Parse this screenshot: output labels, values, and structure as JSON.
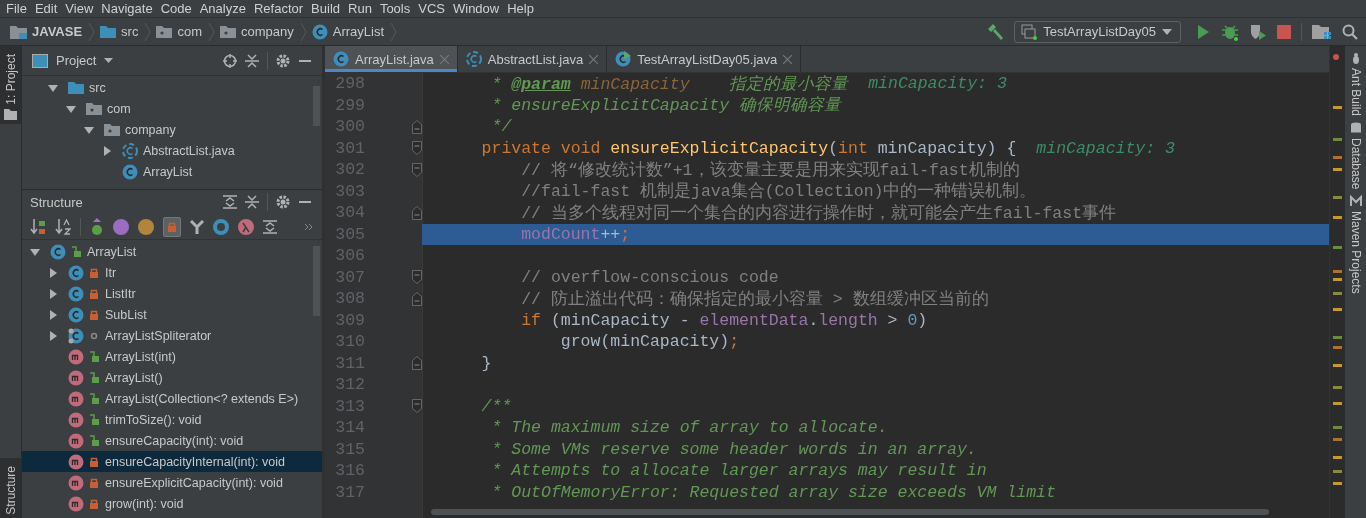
{
  "menu": [
    "File",
    "Edit",
    "View",
    "Navigate",
    "Code",
    "Analyze",
    "Refactor",
    "Build",
    "Run",
    "Tools",
    "VCS",
    "Window",
    "Help"
  ],
  "breadcrumbs": [
    {
      "label": "JAVASE",
      "kind": "module"
    },
    {
      "label": "src",
      "kind": "source"
    },
    {
      "label": "com",
      "kind": "package"
    },
    {
      "label": "company",
      "kind": "package"
    },
    {
      "label": "ArrayList",
      "kind": "class"
    }
  ],
  "run_config": "TestArrayListDay05",
  "left_tool_tabs": [
    {
      "label": "1: Project",
      "selected": true
    },
    {
      "label": "Structure",
      "selected": true
    }
  ],
  "right_tool_tabs": [
    {
      "label": "Ant Build",
      "kind": "ant"
    },
    {
      "label": "Database",
      "kind": "database"
    },
    {
      "label": "Maven Projects",
      "kind": "maven"
    }
  ],
  "project_panel": {
    "title": "Project",
    "tree": [
      {
        "label": "src",
        "kind": "source",
        "expanded": true,
        "children": [
          {
            "label": "com",
            "kind": "package",
            "expanded": true,
            "children": [
              {
                "label": "company",
                "kind": "package",
                "expanded": true,
                "children": [
                  {
                    "label": "AbstractList.java",
                    "kind": "abstract",
                    "expanded": false
                  },
                  {
                    "label": "ArrayList",
                    "kind": "class"
                  }
                ]
              }
            ]
          }
        ]
      }
    ]
  },
  "structure_panel": {
    "title": "Structure",
    "tree": [
      {
        "label": "ArrayList",
        "kind": "class",
        "locked": false,
        "expanded": true,
        "selected": false,
        "children": [
          {
            "label": "Itr",
            "kind": "class",
            "locked": true,
            "expanded": false,
            "selected": false
          },
          {
            "label": "ListItr",
            "kind": "class",
            "locked": true,
            "expanded": false,
            "selected": false
          },
          {
            "label": "SubList",
            "kind": "class",
            "locked": true,
            "expanded": false,
            "selected": false
          },
          {
            "label": "ArrayListSpliterator",
            "kind": "static_class",
            "expanded": false,
            "selected": false
          },
          {
            "label": "ArrayList(int)",
            "kind": "method",
            "locked": false,
            "selected": false
          },
          {
            "label": "ArrayList()",
            "kind": "method",
            "locked": false,
            "selected": false
          },
          {
            "label": "ArrayList(Collection<? extends E>)",
            "kind": "method",
            "locked": false,
            "selected": false
          },
          {
            "label": "trimToSize(): void",
            "kind": "method",
            "locked": false,
            "selected": false
          },
          {
            "label": "ensureCapacity(int): void",
            "kind": "method",
            "locked": false,
            "selected": false
          },
          {
            "label": "ensureCapacityInternal(int): void",
            "kind": "method",
            "locked": true,
            "selected": true
          },
          {
            "label": "ensureExplicitCapacity(int): void",
            "kind": "method",
            "locked": true,
            "selected": false
          },
          {
            "label": "grow(int): void",
            "kind": "method",
            "locked": true,
            "selected": false
          }
        ]
      }
    ]
  },
  "editor_tabs": [
    {
      "label": "ArrayList.java",
      "kind": "class",
      "selected": true
    },
    {
      "label": "AbstractList.java",
      "kind": "abstract",
      "selected": false
    },
    {
      "label": "TestArrayListDay05.java",
      "kind": "runnable",
      "selected": false
    }
  ],
  "code": [
    {
      "number": "298",
      "fold_start": false,
      "fold_end": false,
      "highlighted": false,
      "tokens": [
        {
          "kind": "doc",
          "text": "     * "
        },
        {
          "kind": "doctag",
          "text": "@param"
        },
        {
          "kind": "docname",
          "text": " minCapacity"
        },
        {
          "kind": "doc",
          "text": "    指定的最小容量"
        }
      ],
      "hint": "minCapacity: 3"
    },
    {
      "number": "299",
      "fold_start": false,
      "fold_end": false,
      "highlighted": false,
      "tokens": [
        {
          "kind": "doc",
          "text": "     * ensureExplicitCapacity 确保明确容量"
        }
      ]
    },
    {
      "number": "300",
      "fold_start": false,
      "fold_end": true,
      "highlighted": false,
      "tokens": [
        {
          "kind": "doc",
          "text": "     */"
        }
      ]
    },
    {
      "number": "301",
      "fold_start": true,
      "fold_end": false,
      "highlighted": false,
      "tokens": [
        {
          "kind": "kw",
          "text": "    private void "
        },
        {
          "kind": "fn",
          "text": "ensureExplicitCapacity"
        },
        {
          "kind": "plain",
          "text": "("
        },
        {
          "kind": "kw",
          "text": "int"
        },
        {
          "kind": "plain",
          "text": " minCapacity) {"
        }
      ],
      "hint": "minCapacity: 3"
    },
    {
      "number": "302",
      "fold_start": true,
      "fold_end": false,
      "highlighted": false,
      "tokens": [
        {
          "kind": "comment",
          "text": "        // 将“修改统计数”+1，该变量主要是用来实现fail-fast机制的"
        }
      ]
    },
    {
      "number": "303",
      "fold_start": false,
      "fold_end": false,
      "highlighted": false,
      "tokens": [
        {
          "kind": "comment",
          "text": "        //fail-fast 机制是java集合(Collection)中的一种错误机制。"
        }
      ]
    },
    {
      "number": "304",
      "fold_start": false,
      "fold_end": true,
      "highlighted": false,
      "tokens": [
        {
          "kind": "comment",
          "text": "        // 当多个线程对同一个集合的内容进行操作时，就可能会产生fail-fast事件"
        }
      ]
    },
    {
      "number": "305",
      "fold_start": false,
      "fold_end": false,
      "highlighted": true,
      "tokens": [
        {
          "kind": "field",
          "text": "        modCount"
        },
        {
          "kind": "plain",
          "text": "++"
        },
        {
          "kind": "kw",
          "text": ";"
        }
      ]
    },
    {
      "number": "306",
      "fold_start": false,
      "fold_end": false,
      "highlighted": false
    },
    {
      "number": "307",
      "fold_start": true,
      "fold_end": false,
      "highlighted": false,
      "tokens": [
        {
          "kind": "comment",
          "text": "        // overflow-conscious code"
        }
      ]
    },
    {
      "number": "308",
      "fold_start": false,
      "fold_end": true,
      "highlighted": false,
      "tokens": [
        {
          "kind": "comment",
          "text": "        // 防止溢出代码：确保指定的最小容量 > 数组缓冲区当前的"
        }
      ]
    },
    {
      "number": "309",
      "fold_start": false,
      "fold_end": false,
      "highlighted": false,
      "tokens": [
        {
          "kind": "kw",
          "text": "        if"
        },
        {
          "kind": "plain",
          "text": " (minCapacity - "
        },
        {
          "kind": "field",
          "text": "elementData"
        },
        {
          "kind": "plain",
          "text": "."
        },
        {
          "kind": "field",
          "text": "length"
        },
        {
          "kind": "plain",
          "text": " > "
        },
        {
          "kind": "num",
          "text": "0"
        },
        {
          "kind": "plain",
          "text": ")"
        }
      ]
    },
    {
      "number": "310",
      "fold_start": false,
      "fold_end": false,
      "highlighted": false,
      "tokens": [
        {
          "kind": "plain",
          "text": "            grow(minCapacity)"
        },
        {
          "kind": "kw",
          "text": ";"
        }
      ]
    },
    {
      "number": "311",
      "fold_start": false,
      "fold_end": true,
      "highlighted": false,
      "tokens": [
        {
          "kind": "plain",
          "text": "    }"
        }
      ]
    },
    {
      "number": "312",
      "fold_start": false,
      "fold_end": false,
      "highlighted": false
    },
    {
      "number": "313",
      "fold_start": true,
      "fold_end": false,
      "highlighted": false,
      "tokens": [
        {
          "kind": "doc",
          "text": "    /**"
        }
      ]
    },
    {
      "number": "314",
      "fold_start": false,
      "fold_end": false,
      "highlighted": false,
      "tokens": [
        {
          "kind": "doc",
          "text": "     * The maximum size of array to allocate."
        }
      ]
    },
    {
      "number": "315",
      "fold_start": false,
      "fold_end": false,
      "highlighted": false,
      "tokens": [
        {
          "kind": "doc",
          "text": "     * Some VMs reserve some header words in an array."
        }
      ]
    },
    {
      "number": "316",
      "fold_start": false,
      "fold_end": false,
      "highlighted": false,
      "tokens": [
        {
          "kind": "doc",
          "text": "     * Attempts to allocate larger arrays may result in"
        }
      ]
    },
    {
      "number": "317",
      "fold_start": false,
      "fold_end": false,
      "highlighted": false,
      "tokens": [
        {
          "kind": "doc",
          "text": "     * OutOfMemoryError: Requested array size exceeds VM limit"
        }
      ]
    }
  ]
}
